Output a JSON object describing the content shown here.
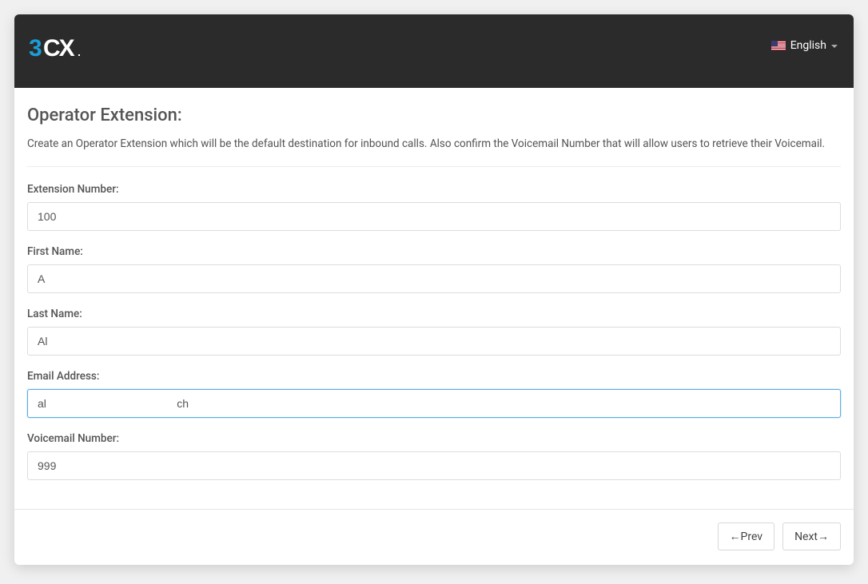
{
  "header": {
    "brand": "3CX",
    "language_label": "English"
  },
  "page": {
    "title": "Operator Extension:",
    "description": "Create an Operator Extension which will be the default destination for inbound calls. Also confirm the Voicemail Number that will allow users to retrieve their Voicemail."
  },
  "form": {
    "extension_number": {
      "label": "Extension Number:",
      "value": "100"
    },
    "first_name": {
      "label": "First Name:",
      "value": "A"
    },
    "last_name": {
      "label": "Last Name:",
      "value": "Al"
    },
    "email": {
      "label": "Email Address:",
      "value": "al                                          ch"
    },
    "voicemail_number": {
      "label": "Voicemail Number:",
      "value": "999"
    }
  },
  "nav": {
    "prev": "←Prev",
    "next": "Next→"
  }
}
